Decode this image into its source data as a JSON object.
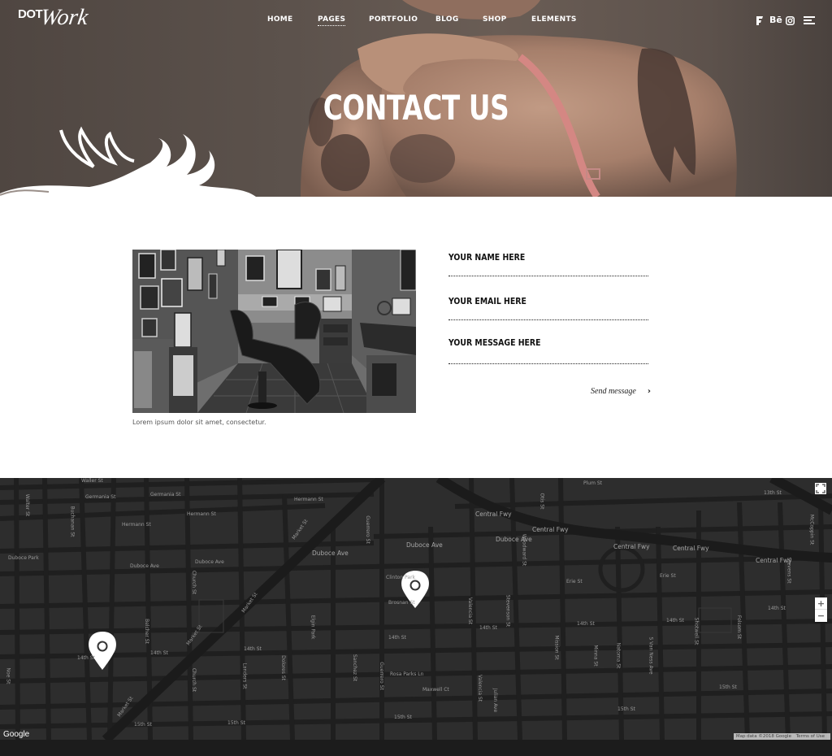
{
  "logo": {
    "part1": "DOT",
    "part2": "Work"
  },
  "nav": [
    {
      "label": "HOME"
    },
    {
      "label": "PAGES"
    },
    {
      "label": "PORTFOLIO"
    },
    {
      "label": "BLOG"
    },
    {
      "label": "SHOP"
    },
    {
      "label": "ELEMENTS"
    }
  ],
  "social": {
    "behance": "Bē"
  },
  "hero": {
    "title": "CONTACT US"
  },
  "content": {
    "caption": "Lorem ipsum dolor sit amet, consectetur."
  },
  "form": {
    "name_placeholder": "YOUR NAME HERE",
    "email_placeholder": "YOUR EMAIL HERE",
    "message_placeholder": "YOUR MESSAGE HERE",
    "send_label": "Send message",
    "send_icon": "›"
  },
  "map": {
    "streets": {
      "waller": "Waller St",
      "germania": "Germania St",
      "hermann": "Hermann St",
      "duboce_park": "Duboce Park",
      "duboce_ave": "Duboce Ave",
      "market": "Market St",
      "fourteenth": "14th St",
      "fifteenth": "15th St",
      "guerrero": "Guerrero St",
      "valencia": "Valencia St",
      "mission": "Mission St",
      "van_ness": "S Van Ness Ave",
      "folsom": "Folsom St",
      "central_fwy": "Central Fwy",
      "dolores": "Dolores St",
      "church": "Church St",
      "sanchez": "Sanchez St",
      "clinton": "Clinton Park",
      "brosnan": "Brosnan St",
      "rosa_parks": "Rosa Parks Ln",
      "julian": "Julian Ave",
      "otis": "Otis St",
      "plum": "Plum St",
      "thirteenth": "13th St",
      "erie": "Erie St",
      "noe": "Noe St",
      "belcher": "Belcher St",
      "landers": "Landers St",
      "woodward": "Woodward St",
      "shotwell": "Shotwell St",
      "stevenson": "Stevenson St",
      "minna": "Minna St",
      "natoma": "Natoma St",
      "maxwell": "Maxwell Ct",
      "elgin": "Elgin Park",
      "mcCoppin": "McCoppin St",
      "stevens": "Stevens St",
      "buchanan": "Buchanan St",
      "walter": "Walter St"
    },
    "zoom_in": "+",
    "zoom_out": "−",
    "google_label": "Google",
    "map_data": "Map data ©2018 Google",
    "terms": "Terms of Use"
  },
  "colors": {
    "hero_bg": "#5c524c",
    "map_bg": "#2d2d2d",
    "map_road": "#1f1f1f",
    "pin": "#ffffff"
  }
}
